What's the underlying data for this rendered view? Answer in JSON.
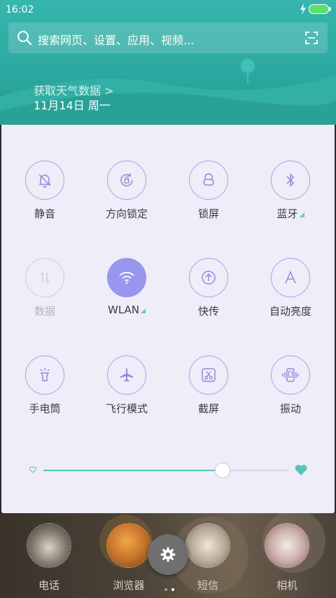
{
  "status_bar": {
    "time": "16:02"
  },
  "search": {
    "placeholder": "搜索网页、设置、应用、视频..."
  },
  "weather": {
    "link": "获取天气数据 >",
    "date": "11月14日  周一"
  },
  "toggles": [
    {
      "label": "静音",
      "icon": "bell-off-icon",
      "state": "off"
    },
    {
      "label": "方向锁定",
      "icon": "rotation-lock-icon",
      "state": "off"
    },
    {
      "label": "锁屏",
      "icon": "lock-icon",
      "state": "off"
    },
    {
      "label": "蓝牙",
      "icon": "bluetooth-icon",
      "state": "off",
      "has_menu": true
    },
    {
      "label": "数据",
      "icon": "data-arrows-icon",
      "state": "disabled"
    },
    {
      "label": "WLAN",
      "icon": "wifi-icon",
      "state": "on",
      "has_menu": true
    },
    {
      "label": "快传",
      "icon": "upload-icon",
      "state": "off"
    },
    {
      "label": "自动亮度",
      "icon": "auto-brightness-icon",
      "state": "off"
    },
    {
      "label": "手电筒",
      "icon": "flashlight-icon",
      "state": "off"
    },
    {
      "label": "飞行模式",
      "icon": "airplane-icon",
      "state": "off"
    },
    {
      "label": "截屏",
      "icon": "screenshot-icon",
      "state": "off"
    },
    {
      "label": "振动",
      "icon": "vibrate-icon",
      "state": "off"
    }
  ],
  "brightness": {
    "level": 0.73
  },
  "dock": {
    "apps": [
      {
        "label": "电话"
      },
      {
        "label": "浏览器"
      },
      {
        "label": "短信"
      },
      {
        "label": "相机"
      }
    ]
  },
  "colors": {
    "accent": "#9896ee",
    "teal": "#55c6bb",
    "header": "#2ca89f"
  }
}
